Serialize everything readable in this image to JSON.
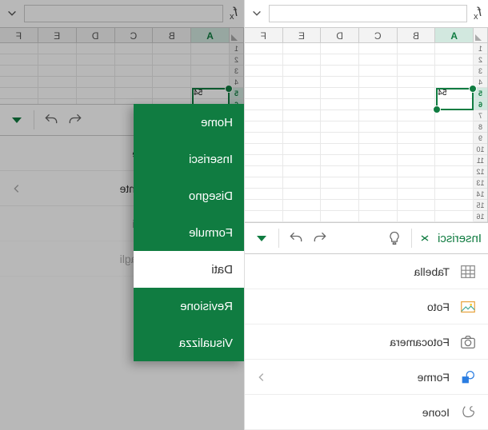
{
  "formula_fx": "fx",
  "columns": [
    "A",
    "B",
    "C",
    "D",
    "E",
    "F"
  ],
  "cell_value": "54",
  "toolbar": {
    "tab_label": "Inserisci"
  },
  "insert_panel": {
    "items": [
      {
        "label": "Tabella",
        "icon": "table"
      },
      {
        "label": "Foto",
        "icon": "photo"
      },
      {
        "label": "Fotocamera",
        "icon": "camera"
      },
      {
        "label": "Forme",
        "icon": "shapes"
      },
      {
        "label": "Icone",
        "icon": "icons"
      }
    ]
  },
  "sort_panel": {
    "items": [
      {
        "label": "ento crescente",
        "icon": "sort-asc"
      },
      {
        "label": "ento decrescente",
        "icon": "sort-desc"
      },
      {
        "label": "Mostra dettagli",
        "icon": "expand"
      },
      {
        "label": "Nascondi dettagli",
        "icon": "collapse"
      }
    ]
  },
  "ribbon_menu": {
    "items": [
      "Home",
      "Inserisci",
      "Disegno",
      "Formule",
      "Dati",
      "Revisione",
      "Visualizza"
    ],
    "active": "Dati"
  },
  "colors": {
    "excel_green": "#107c41"
  }
}
